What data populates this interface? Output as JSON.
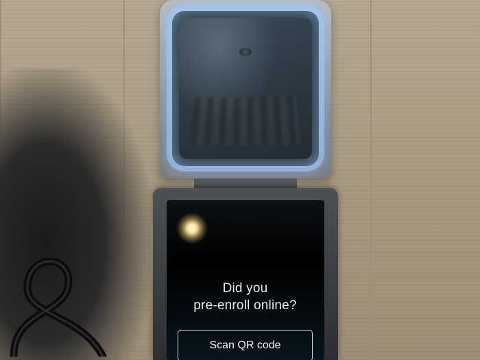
{
  "kiosk": {
    "prompt_line1": "Did you",
    "prompt_line2": "pre-enroll online?",
    "button_label": "Scan QR code"
  }
}
